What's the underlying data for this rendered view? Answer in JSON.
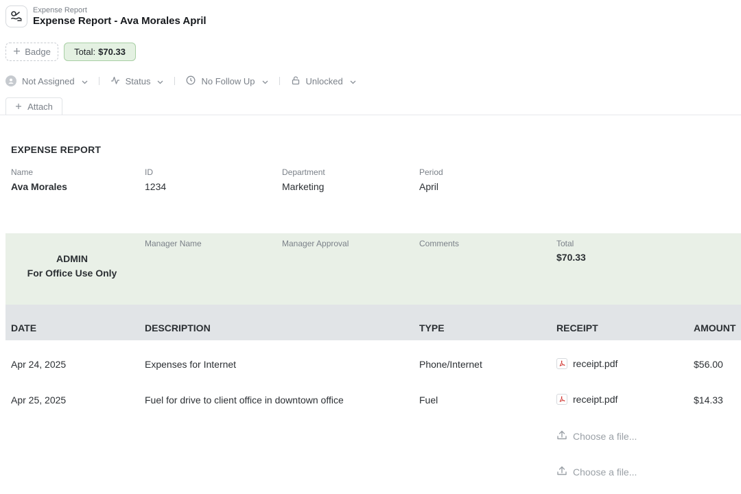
{
  "header": {
    "breadcrumb": "Expense Report",
    "title": "Expense Report - Ava Morales April"
  },
  "badges": {
    "add_label": "Badge",
    "total_label": "Total:",
    "total_value": "$70.33"
  },
  "toolbar": {
    "assignee": "Not Assigned",
    "status": "Status",
    "follow_up": "No Follow Up",
    "lock": "Unlocked"
  },
  "attach_label": "Attach",
  "report": {
    "section_title": "EXPENSE REPORT",
    "fields": [
      {
        "label": "Name",
        "value": "Ava Morales"
      },
      {
        "label": "ID",
        "value": "1234"
      },
      {
        "label": "Department",
        "value": "Marketing"
      },
      {
        "label": "Period",
        "value": "April"
      }
    ]
  },
  "admin": {
    "title_line1": "ADMIN",
    "title_line2": "For Office Use Only",
    "manager_name_label": "Manager Name",
    "manager_approval_label": "Manager Approval",
    "comments_label": "Comments",
    "total_label": "Total",
    "total_value": "$70.33"
  },
  "table": {
    "columns": [
      "DATE",
      "DESCRIPTION",
      "TYPE",
      "RECEIPT",
      "AMOUNT"
    ],
    "rows": [
      {
        "date": "Apr 24, 2025",
        "description": "Expenses for Internet",
        "type": "Phone/Internet",
        "receipt": "receipt.pdf",
        "amount": "$56.00"
      },
      {
        "date": "Apr 25, 2025",
        "description": "Fuel for drive to client office in downtown office",
        "type": "Fuel",
        "receipt": "receipt.pdf",
        "amount": "$14.33"
      }
    ],
    "upload_placeholder": "Choose a file..."
  },
  "colors": {
    "total_badge_bg": "#e4f1e2",
    "admin_bg": "#e9f0e7",
    "table_header_bg": "#e1e4e7",
    "pdf_red": "#d0322d"
  }
}
